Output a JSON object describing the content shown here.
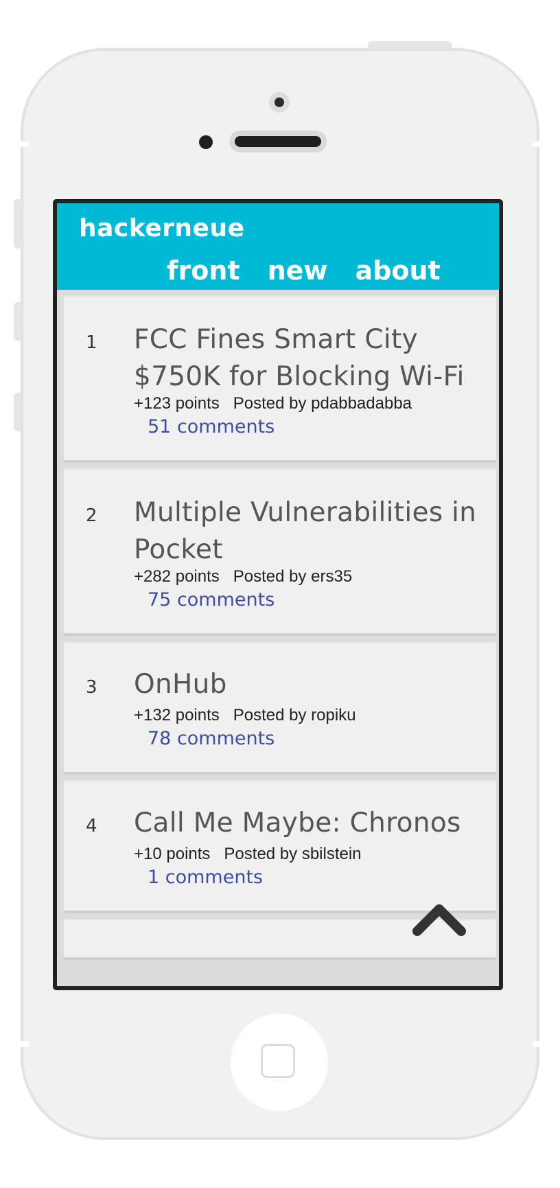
{
  "app": {
    "brand": "hackerneue",
    "nav": [
      "front",
      "new",
      "about"
    ]
  },
  "stories": [
    {
      "rank": "1",
      "title": "FCC Fines Smart City $750K for Blocking Wi-Fi",
      "points": "+123 points",
      "posted": "Posted by pdabbadabba",
      "comments": "51 comments"
    },
    {
      "rank": "2",
      "title": "Multiple Vulnerabilities in Pocket",
      "points": "+282 points",
      "posted": "Posted by ers35",
      "comments": "75 comments"
    },
    {
      "rank": "3",
      "title": "OnHub",
      "points": "+132 points",
      "posted": "Posted by ropiku",
      "comments": "78 comments"
    },
    {
      "rank": "4",
      "title": "Call Me Maybe: Chronos",
      "points": "+10 points",
      "posted": "Posted by sbilstein",
      "comments": "1 comments"
    }
  ],
  "scroll_top": {
    "icon": "chevron-up-icon"
  },
  "colors": {
    "header": "#00b9d5",
    "link": "#3e4f9e",
    "card": "#f0f0f0"
  }
}
